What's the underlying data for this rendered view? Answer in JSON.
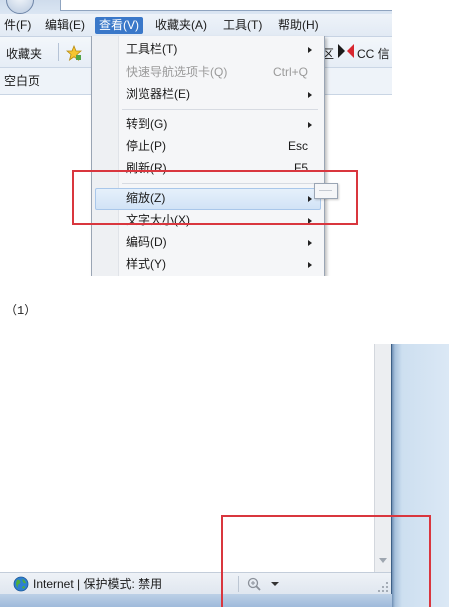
{
  "menubar": {
    "items": [
      "件(F)",
      "编辑(E)",
      "查看(V)",
      "收藏夹(A)",
      "工具(T)",
      "帮助(H)"
    ],
    "active_index": 2
  },
  "favorites_bar": {
    "favorites_label": "收藏夹",
    "right_text_1": "区",
    "right_text_2": "CC 信"
  },
  "tab": {
    "label": "空白页"
  },
  "view_menu": {
    "items": [
      {
        "label": "工具栏(T)",
        "shortcut": "",
        "submenu": true,
        "disabled": false
      },
      {
        "label": "快速导航选项卡(Q)",
        "shortcut": "Ctrl+Q",
        "submenu": false,
        "disabled": true
      },
      {
        "label": "浏览器栏(E)",
        "shortcut": "",
        "submenu": true,
        "disabled": false
      },
      {
        "label": "转到(G)",
        "shortcut": "",
        "submenu": true,
        "disabled": false
      },
      {
        "label": "停止(P)",
        "shortcut": "Esc",
        "submenu": false,
        "disabled": false
      },
      {
        "label": "刷新(R)",
        "shortcut": "F5",
        "submenu": false,
        "disabled": false
      },
      {
        "label": "缩放(Z)",
        "shortcut": "",
        "submenu": true,
        "disabled": false
      },
      {
        "label": "文字大小(X)",
        "shortcut": "",
        "submenu": true,
        "disabled": false
      },
      {
        "label": "编码(D)",
        "shortcut": "",
        "submenu": true,
        "disabled": false
      },
      {
        "label": "样式(Y)",
        "shortcut": "",
        "submenu": true,
        "disabled": false
      }
    ],
    "highlighted_index": 6
  },
  "caption_1": "（1）",
  "statusbar": {
    "zone_text": "Internet | 保护模式: 禁用"
  },
  "colors": {
    "annotation_red": "#d9363e",
    "menu_active": "#3a78c9"
  }
}
